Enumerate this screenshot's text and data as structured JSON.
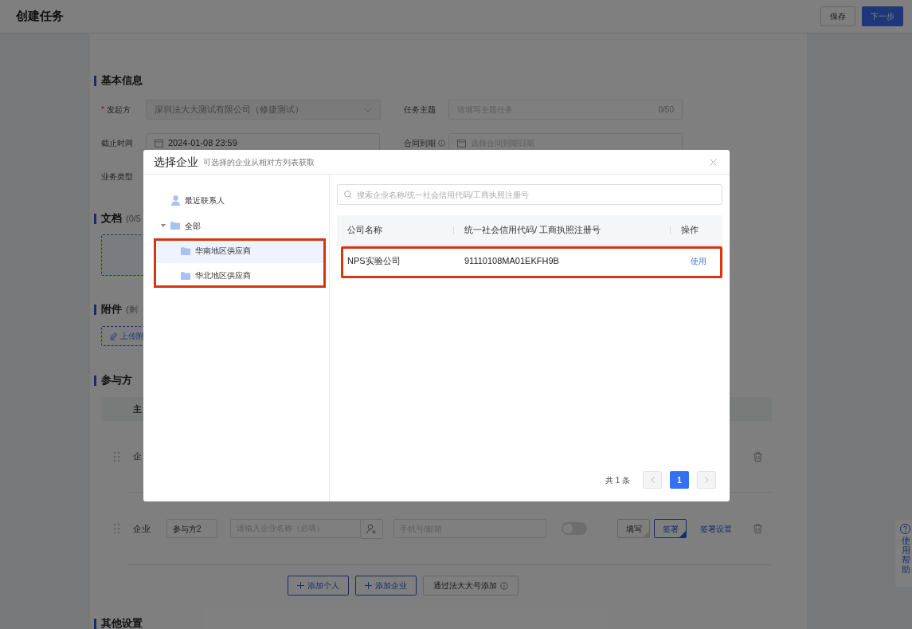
{
  "header": {
    "title": "创建任务",
    "buttons": [
      {
        "label": "保存",
        "primary": false
      },
      {
        "label": "下一步",
        "primary": true
      }
    ]
  },
  "basic_info": {
    "title": "基本信息",
    "fields": [
      {
        "label": "发起方",
        "required_mark": "*",
        "info": false,
        "kind": "select",
        "value": "深圳法大大测试有限公司（修捷测试）"
      },
      {
        "label": "任务主题",
        "info": false,
        "kind": "text",
        "placeholder": "请填写主题任务",
        "counter": "0/50"
      },
      {
        "label": "截止时间",
        "info": false,
        "kind": "date",
        "value": "2024-01-08 23:59"
      },
      {
        "label": "合同到期",
        "info": true,
        "kind": "date",
        "placeholder": "选择合同到期日期"
      },
      {
        "label": "业务类型",
        "info": false,
        "kind": "blank"
      }
    ]
  },
  "documents": {
    "title": "文档",
    "note": "(0/5"
  },
  "attachments": {
    "title": "附件",
    "note": "(剩",
    "upload_button": "上传附"
  },
  "participants": {
    "title": "参与方",
    "header_cell": "主",
    "rows": [
      {
        "kind": "partial",
        "type_label": "企"
      },
      {
        "kind": "full",
        "type_label": "企业",
        "name": "参与方2",
        "company_placeholder": "请输入企业名称（必填）",
        "contact_placeholder": "手机号/邮箱",
        "on": false,
        "actions": [
          {
            "label": "填写",
            "selected": false
          },
          {
            "label": "签署",
            "selected": true
          }
        ],
        "settings_link": "签署设置"
      }
    ],
    "add_buttons": [
      {
        "label": "添加个人",
        "kind": "add"
      },
      {
        "label": "添加企业",
        "kind": "add"
      },
      {
        "label": "通过法大大号添加",
        "kind": "info"
      }
    ]
  },
  "other_settings": {
    "title": "其他设置"
  },
  "help_tab": {
    "label": "使用帮助"
  },
  "dialog": {
    "title": "选择企业",
    "subtitle": "可选择的企业从相对方列表获取",
    "tree": [
      {
        "label": "最近联系人",
        "kind": "contact",
        "selected": false
      },
      {
        "label": "全部",
        "kind": "folder",
        "expanded": true,
        "selected": false,
        "children_highlighted": true,
        "children": [
          {
            "label": "华南地区供应商",
            "kind": "folder",
            "selected": true
          },
          {
            "label": "华北地区供应商",
            "kind": "folder",
            "selected": false
          }
        ]
      }
    ],
    "search": {
      "placeholder": "搜索企业名称/统一社会信用代码/工商执照注册号"
    },
    "table": {
      "columns": [
        "公司名称",
        "统一社会信用代码/ 工商执照注册号",
        "操作"
      ],
      "rows": [
        {
          "name": "NPS实验公司",
          "code": "91110108MA01EKFH9B",
          "action": "使用",
          "highlighted": true
        }
      ]
    },
    "pagination": {
      "total": "共 1 条",
      "pages": [
        {
          "label": "1",
          "selected": true
        }
      ]
    }
  }
}
